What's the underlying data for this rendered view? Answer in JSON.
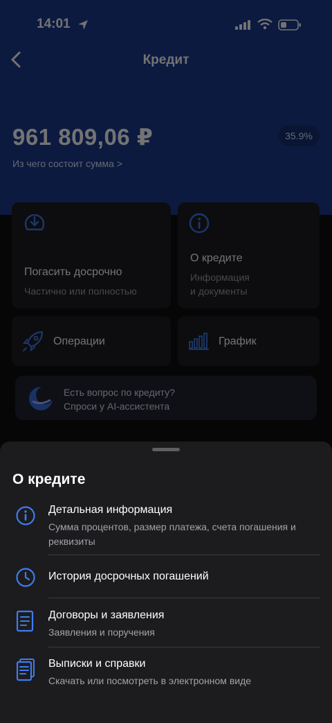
{
  "status_bar": {
    "time": "14:01"
  },
  "header": {
    "title": "Кредит"
  },
  "balance": {
    "amount": "961 809,06 ₽",
    "breakdown_link": "Из чего состоит сумма >",
    "rate": "35.9%"
  },
  "actions": [
    {
      "title": "Погасить досрочно",
      "subtitle": "Частично или полностью",
      "icon": "download-circle-icon"
    },
    {
      "title": "О кредите",
      "subtitle": "Информация\nи документы",
      "icon": "info-icon"
    },
    {
      "title": "Операции",
      "icon": "rocket-icon"
    },
    {
      "title": "График",
      "icon": "bar-chart-icon"
    }
  ],
  "ai_assistant": {
    "line1": "Есть вопрос по кредиту?",
    "line2": "Спроси у AI-ассистента"
  },
  "sheet": {
    "title": "О кредите",
    "items": [
      {
        "title": "Детальная информация",
        "subtitle": "Сумма процентов, размер платежа, счета погашения и реквизиты",
        "icon": "info-icon"
      },
      {
        "title": "История досрочных погашений",
        "subtitle": "",
        "icon": "clock-icon"
      },
      {
        "title": "Договоры и заявления",
        "subtitle": "Заявления и поручения",
        "icon": "document-icon"
      },
      {
        "title": "Выписки и справки",
        "subtitle": "Скачать или посмотреть в электронном виде",
        "icon": "documents-stack-icon"
      }
    ]
  },
  "colors": {
    "brand_blue": "#1b3a8e",
    "accent_icon": "#3f7bef",
    "sheet_bg": "#1c1c1e"
  }
}
